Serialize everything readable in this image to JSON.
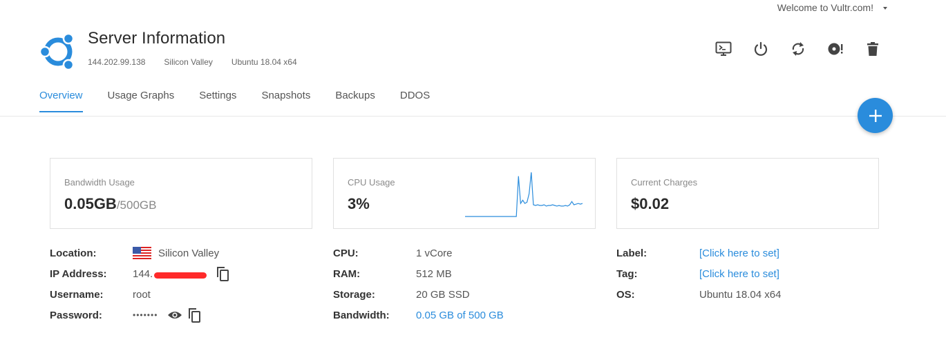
{
  "topbar": {
    "welcome": "Welcome to Vultr.com!"
  },
  "header": {
    "title": "Server Information",
    "ip": "144.202.99.138",
    "location": "Silicon Valley",
    "os": "Ubuntu 18.04 x64",
    "logo_icon": "ubuntu-logo-icon"
  },
  "actions": [
    {
      "icon": "console-icon"
    },
    {
      "icon": "power-icon"
    },
    {
      "icon": "restart-icon"
    },
    {
      "icon": "iso-icon"
    },
    {
      "icon": "trash-icon"
    }
  ],
  "tabs": [
    "Overview",
    "Usage Graphs",
    "Settings",
    "Snapshots",
    "Backups",
    "DDOS"
  ],
  "active_tab": "Overview",
  "cards": {
    "bandwidth": {
      "label": "Bandwidth Usage",
      "value": "0.05GB",
      "sub": "/500GB"
    },
    "cpu": {
      "label": "CPU Usage",
      "value": "3%",
      "sparkline": [
        0,
        0,
        0,
        0,
        0,
        0,
        0,
        0,
        0,
        0,
        0,
        0,
        0,
        0,
        0,
        0,
        0,
        0,
        0,
        0,
        0,
        0,
        0,
        0,
        0,
        62,
        20,
        25,
        20,
        22,
        35,
        68,
        18,
        17,
        18,
        17,
        17,
        18,
        16,
        17,
        17,
        18,
        17,
        16,
        17,
        16,
        16,
        17,
        16,
        18,
        23,
        18,
        19,
        20,
        19,
        20
      ]
    },
    "charges": {
      "label": "Current Charges",
      "value": "$0.02"
    }
  },
  "details_left": {
    "location_key": "Location:",
    "location_val": "Silicon Valley",
    "ip_key": "IP Address:",
    "ip_val": "144.",
    "username_key": "Username:",
    "username_val": "root",
    "password_key": "Password:",
    "password_val": "•••••••"
  },
  "details_mid": {
    "cpu_key": "CPU:",
    "cpu_val": "1 vCore",
    "ram_key": "RAM:",
    "ram_val": "512 MB",
    "storage_key": "Storage:",
    "storage_val": "20 GB SSD",
    "bandwidth_key": "Bandwidth:",
    "bandwidth_val": "0.05 GB of 500 GB"
  },
  "details_right": {
    "label_key": "Label:",
    "label_val": "[Click here to set]",
    "tag_key": "Tag:",
    "tag_val": "[Click here to set]",
    "os_key": "OS:",
    "os_val": "Ubuntu 18.04 x64"
  },
  "colors": {
    "accent": "#2a8cdc",
    "redaction": "#ff2a2a"
  }
}
